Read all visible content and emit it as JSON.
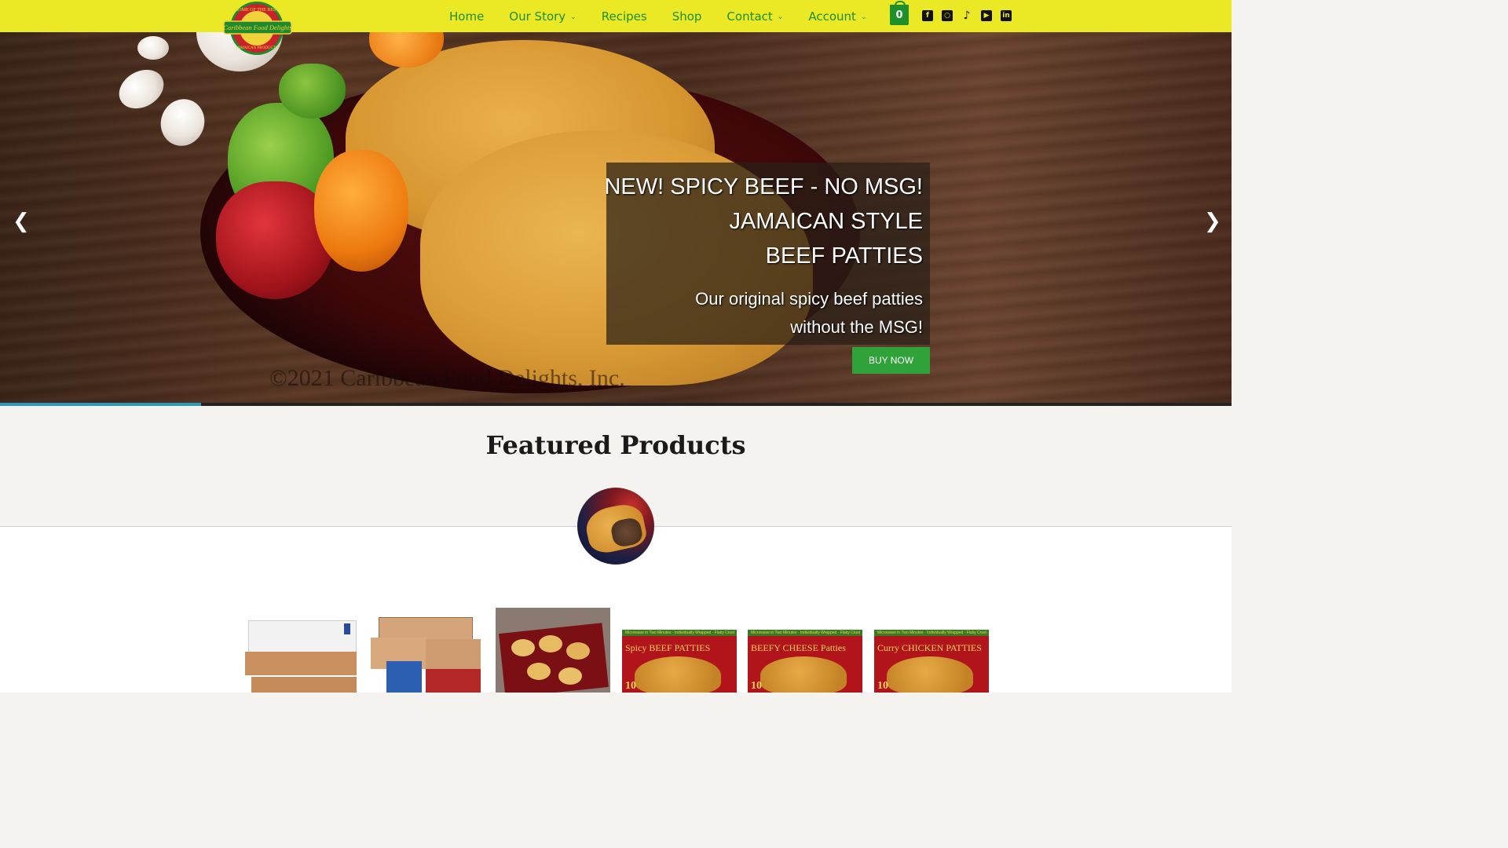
{
  "header": {
    "logo_alt": "Caribbean Food Delights",
    "logo_text_top": "HOME OF THE BEST",
    "logo_text_main": "Caribbean Food Delights",
    "logo_text_bottom": "JAMAICAN PRODUCTS",
    "nav": [
      {
        "label": "Home",
        "dropdown": false
      },
      {
        "label": "Our Story",
        "dropdown": true
      },
      {
        "label": "Recipes",
        "dropdown": false
      },
      {
        "label": "Shop",
        "dropdown": false
      },
      {
        "label": "Contact",
        "dropdown": true
      },
      {
        "label": "Account",
        "dropdown": true
      }
    ],
    "cart_count": "0",
    "social": [
      "facebook-icon",
      "instagram-icon",
      "tiktok-icon",
      "youtube-icon",
      "linkedin-icon"
    ],
    "colors": {
      "bar": "#ebe826",
      "accent": "#1e8f2b"
    }
  },
  "hero": {
    "title_lines": [
      "NEW! SPICY BEEF - NO MSG!",
      "JAMAICAN STYLE",
      "BEEF PATTIES"
    ],
    "subtitle_lines": [
      "Our original spicy beef patties",
      "without the MSG!"
    ],
    "button": "BUY NOW",
    "watermark": "©2021 Caribbean Food Delights, Inc.",
    "prev_icon": "chevron-left-icon",
    "next_icon": "chevron-right-icon",
    "progress_fraction": 0.163
  },
  "featured": {
    "title": "Featured Products",
    "products": [
      {
        "type": "case"
      },
      {
        "type": "variety"
      },
      {
        "type": "tray"
      },
      {
        "type": "pack",
        "label": "Spicy BEEF PATTIES",
        "strip": "Microwave in Two Minutes · Individually Wrapped · Flaky Crust",
        "count": "10"
      },
      {
        "type": "pack",
        "label": "BEEFY CHEESE Patties",
        "strip": "Microwave in Two Minutes · Individually Wrapped · Flaky Crust",
        "count": "10"
      },
      {
        "type": "pack",
        "label": "Curry CHICKEN PATTIES",
        "strip": "Microwave in Two Minutes · Individually Wrapped · Flaky Crust",
        "count": "10"
      }
    ]
  }
}
